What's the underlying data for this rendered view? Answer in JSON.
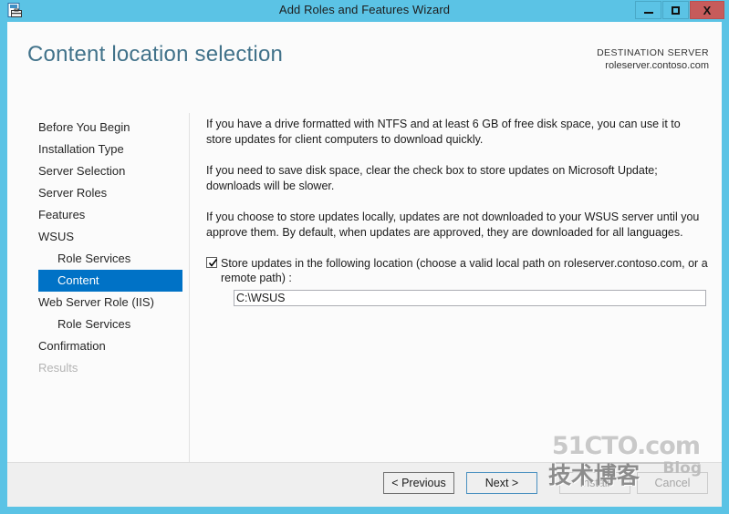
{
  "window": {
    "title": "Add Roles and Features Wizard",
    "icon": "server-wizard-icon",
    "minimize_label": "Minimize",
    "maximize_label": "Maximize",
    "close_label": "X"
  },
  "header": {
    "page_title": "Content location selection",
    "destination_label": "DESTINATION SERVER",
    "destination_value": "roleserver.contoso.com"
  },
  "sidebar": {
    "items": [
      {
        "label": "Before You Begin",
        "state": "normal",
        "indent": false
      },
      {
        "label": "Installation Type",
        "state": "normal",
        "indent": false
      },
      {
        "label": "Server Selection",
        "state": "normal",
        "indent": false
      },
      {
        "label": "Server Roles",
        "state": "normal",
        "indent": false
      },
      {
        "label": "Features",
        "state": "normal",
        "indent": false
      },
      {
        "label": "WSUS",
        "state": "normal",
        "indent": false
      },
      {
        "label": "Role Services",
        "state": "normal",
        "indent": true
      },
      {
        "label": "Content",
        "state": "selected",
        "indent": true
      },
      {
        "label": "Web Server Role (IIS)",
        "state": "normal",
        "indent": false
      },
      {
        "label": "Role Services",
        "state": "normal",
        "indent": true
      },
      {
        "label": "Confirmation",
        "state": "normal",
        "indent": false
      },
      {
        "label": "Results",
        "state": "disabled",
        "indent": false
      }
    ]
  },
  "content": {
    "paragraph1": "If you have a drive formatted with NTFS and at least 6 GB of free disk space, you can use it to store updates for client computers to download quickly.",
    "paragraph2": "If you need to save disk space, clear the check box to store updates on Microsoft Update; downloads will be slower.",
    "paragraph3": "If you choose to store updates locally, updates are not downloaded to your WSUS server until you approve them. By default, when updates are approved, they are downloaded for all languages.",
    "store_checkbox": {
      "label": "Store updates in the following location (choose a valid local path on roleserver.contoso.com, or a remote path) :",
      "checked": true
    },
    "path_field": {
      "value": "C:\\WSUS",
      "placeholder": ""
    }
  },
  "footer": {
    "previous_label": "< Previous",
    "next_label": "Next >",
    "install_label": "Install",
    "cancel_label": "Cancel"
  },
  "watermark": {
    "site": "51CTO.com",
    "chinese": "技术博客",
    "blog": "Blog"
  },
  "colors": {
    "titlebar": "#5bc3e5",
    "close_button": "#c75b5b",
    "selection": "#0072c6",
    "page_title": "#41728a",
    "footer": "#efefef"
  }
}
